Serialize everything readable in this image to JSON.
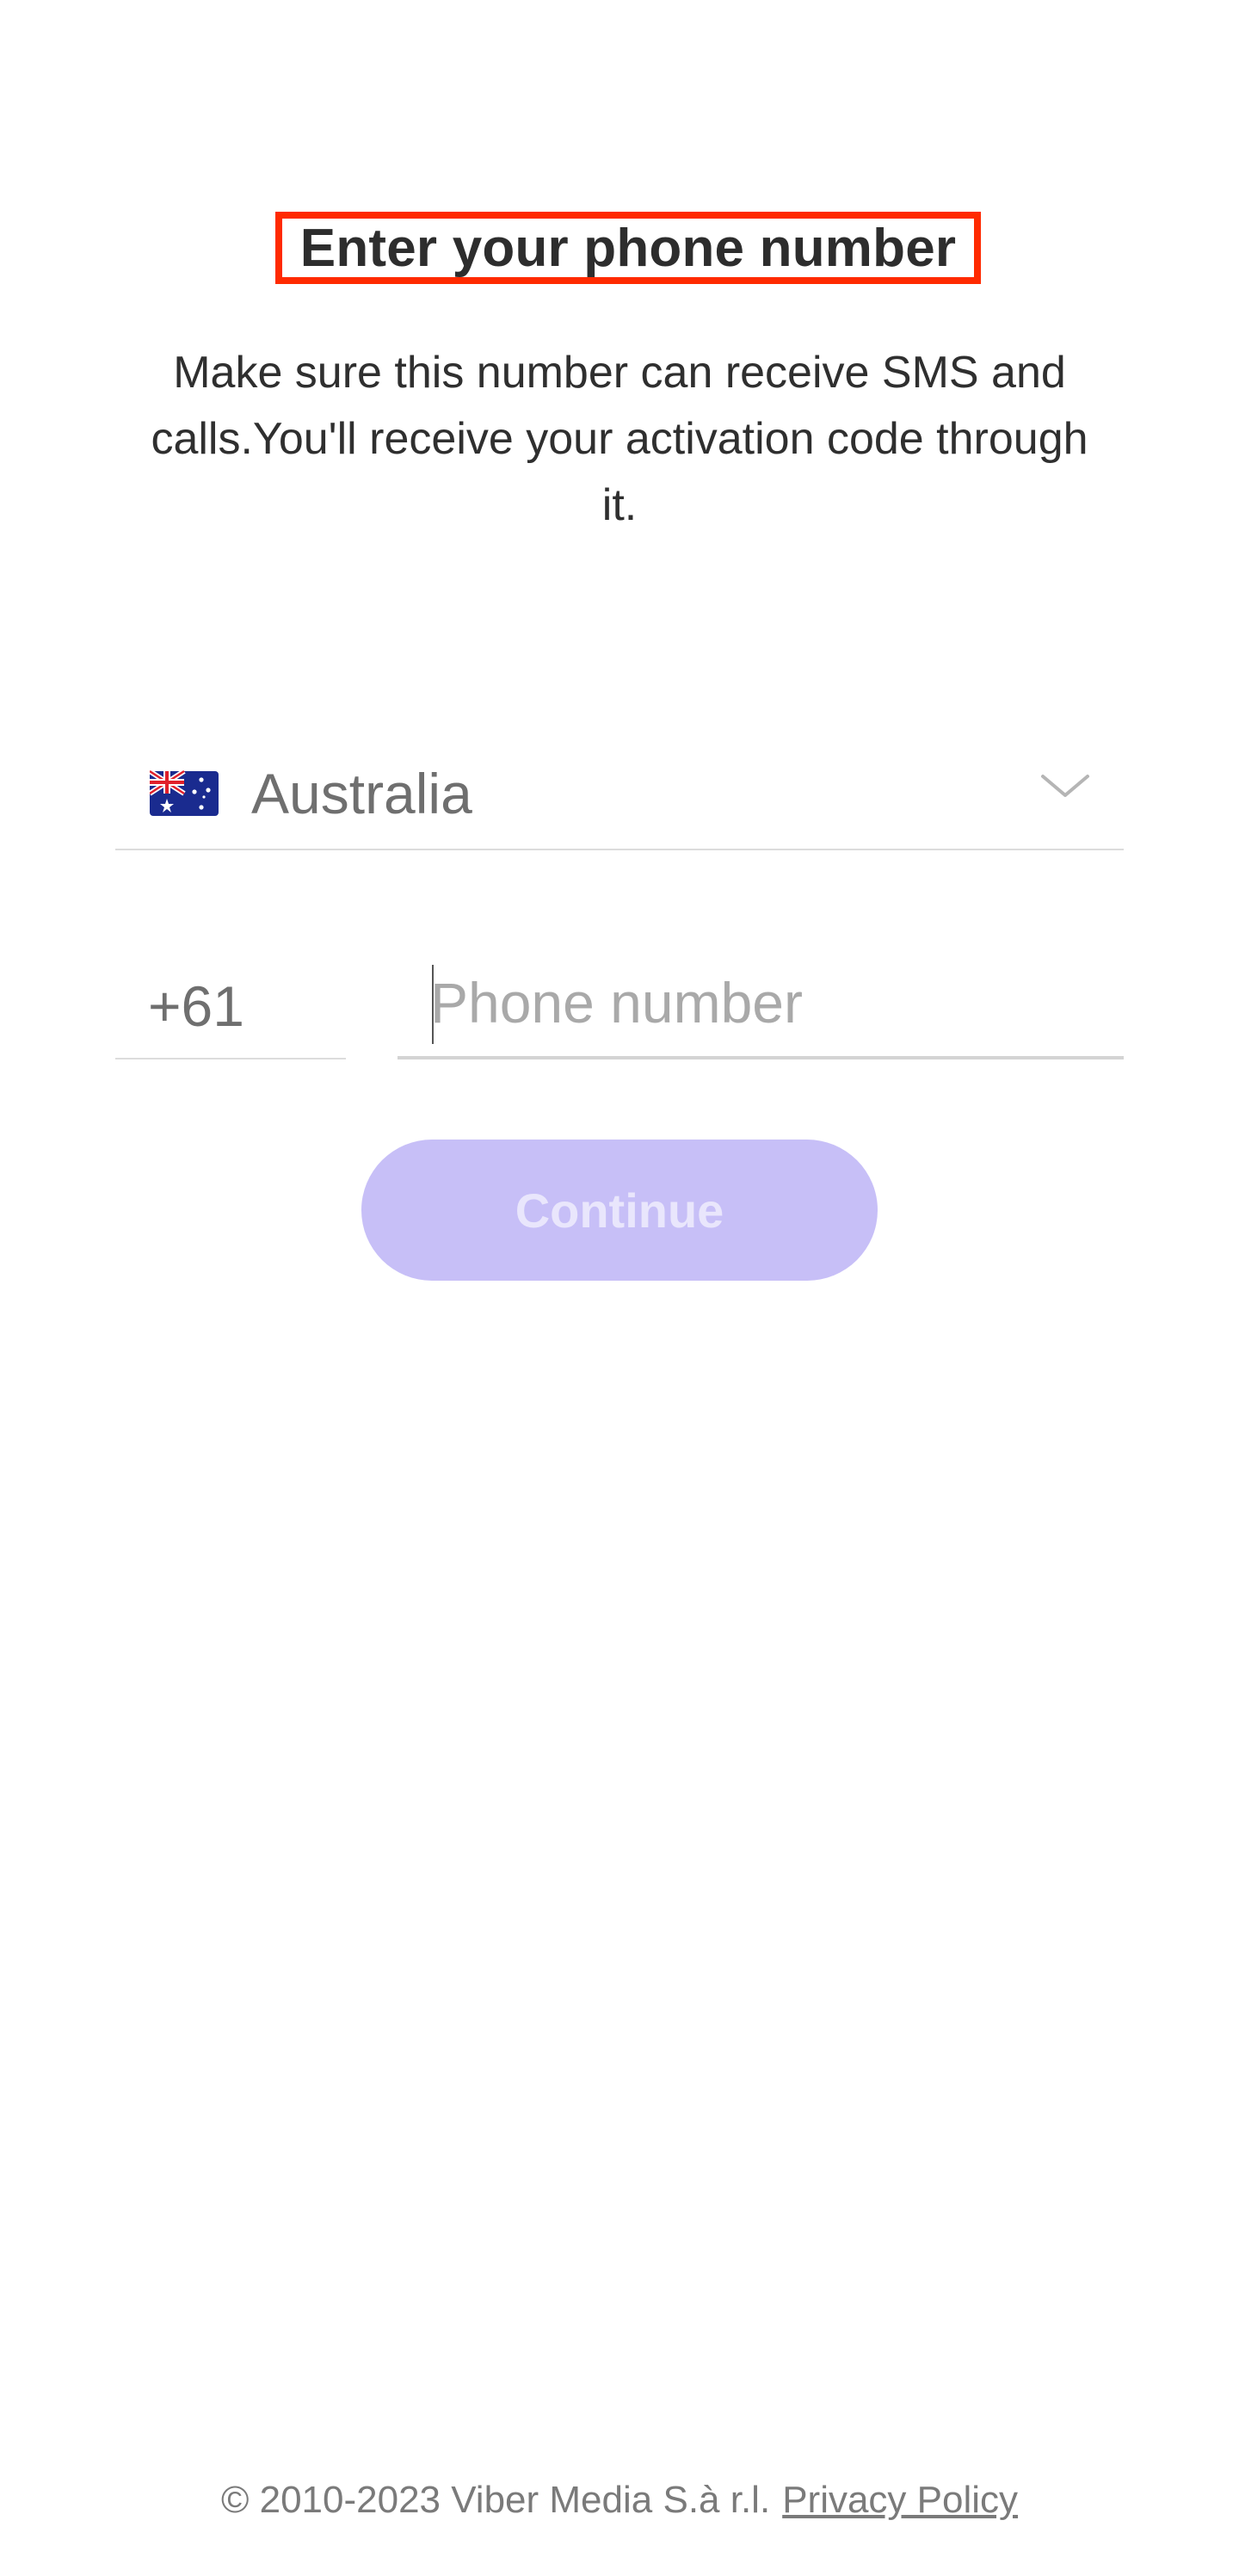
{
  "header": {
    "title": "Enter your phone number",
    "subtitle": "Make sure this number can receive SMS and calls.You'll receive your activation code through it."
  },
  "country_selector": {
    "flag_icon": "australia-flag-icon",
    "country_name": "Australia",
    "dropdown_icon": "chevron-down-icon"
  },
  "phone": {
    "country_code": "+61",
    "value": "",
    "placeholder": "Phone number"
  },
  "actions": {
    "continue_label": "Continue",
    "continue_color": "#c7bff7",
    "continue_enabled": false
  },
  "footer": {
    "copyright": "© 2010-2023 Viber Media S.à r.l.",
    "privacy_label": "Privacy Policy"
  },
  "colors": {
    "highlight_border": "#ff2a00"
  }
}
